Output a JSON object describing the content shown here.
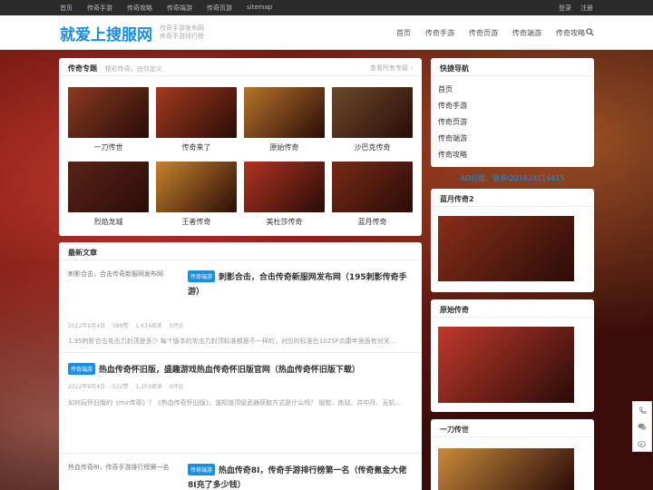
{
  "topbar": {
    "nav": [
      "首页",
      "传奇手游",
      "传奇攻略",
      "传奇端游",
      "传奇页游",
      "sitemap"
    ],
    "login": "登录",
    "register": "注册"
  },
  "header": {
    "logo": "就爱上搜服网",
    "slogan_line1": "传奇手游发布网",
    "slogan_line2": "传奇手游排行榜",
    "nav": [
      "首页",
      "传奇手游",
      "传奇页游",
      "传奇端游",
      "传奇攻略"
    ]
  },
  "topics": {
    "title": "传奇专题",
    "subtitle": "精彩传奇，由你定义",
    "more": "查看所有专题 ›",
    "items": [
      {
        "name": "一刀传世",
        "color": "#8a3a20"
      },
      {
        "name": "传奇来了",
        "color": "#a33b1e"
      },
      {
        "name": "原始传奇",
        "color": "#b8742a"
      },
      {
        "name": "沙巴克传奇",
        "color": "#6a4a2a"
      },
      {
        "name": "烈焰龙城",
        "color": "#5a2416"
      },
      {
        "name": "王者传奇",
        "color": "#c9822c"
      },
      {
        "name": "美杜莎传奇",
        "color": "#b03420"
      },
      {
        "name": "蓝月传奇",
        "color": "#7a2a14"
      }
    ]
  },
  "articles": {
    "title": "最新文章",
    "items": [
      {
        "img_alt": "刺影合击，合击传奇新服网发布网",
        "category": "传奇端游",
        "title": "刺影合击，合击传奇新服网发布网（195刺影传奇手游）",
        "date": "2022年9月4日",
        "likes": "589赞",
        "views": "1,634阅读",
        "comments": "0评论",
        "excerpt": "1.95刺影合击攻击力封顶是多少 每个版本的攻击力封顶标准都是不一样的，对应的标准在102SF点康年里面有对关..."
      },
      {
        "category": "传奇端游",
        "title": "热血传奇怀旧版，盛趣游戏热血传奇怀旧版官网（热血传奇怀旧版下载）",
        "date": "2022年9月4日",
        "likes": "522赞",
        "views": "1,253阅读",
        "comments": "0评论",
        "excerpt": "如何玩怀旧版的《mir传奇》？《热血传奇怀旧版》，谁知道顶级武器获取方式是什么吗？ 锻蛇、炼狱、井中月、无机..."
      },
      {
        "img_alt": "热血传奇8I，传奇手游排行榜第一名",
        "category": "传奇端游",
        "title": "热血传奇8I，传奇手游排行榜第一名（传奇氪金大佬8I充了多少钱）"
      }
    ]
  },
  "sidebar": {
    "quicknav_title": "快捷导航",
    "quicknav": [
      "首页",
      "传奇手游",
      "传奇页游",
      "传奇端游",
      "传奇攻略"
    ],
    "ad": "AD招租，联系QQ1624516415",
    "widgets": [
      {
        "title": "蓝月传奇2",
        "color": "#8a2e18"
      },
      {
        "title": "原始传奇",
        "color": "#c0392b"
      },
      {
        "title": "一刀传世",
        "color": "#c98a3a"
      }
    ]
  }
}
